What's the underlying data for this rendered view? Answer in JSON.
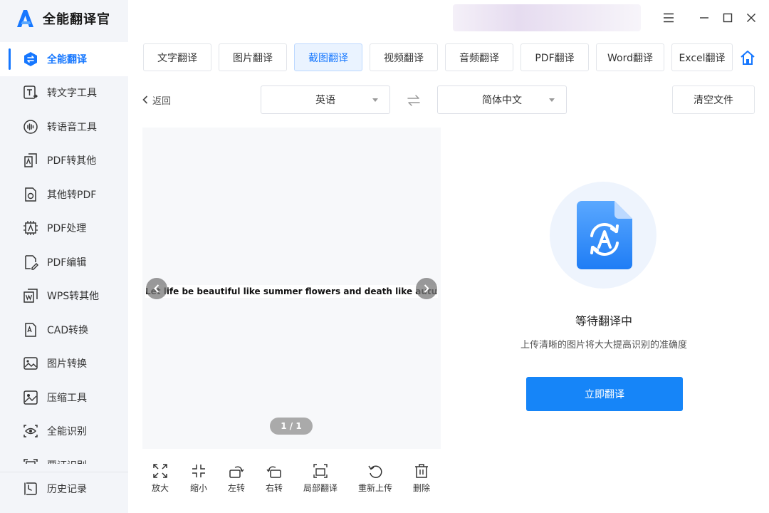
{
  "app": {
    "title": "全能翻译官",
    "accent_color": "#1677ff"
  },
  "sidebar": {
    "items": [
      {
        "label": "全能翻译",
        "icon": "translate-icon"
      },
      {
        "label": "转文字工具",
        "icon": "text-convert-icon"
      },
      {
        "label": "转语音工具",
        "icon": "voice-icon"
      },
      {
        "label": "PDF转其他",
        "icon": "pdf-export-icon"
      },
      {
        "label": "其他转PDF",
        "icon": "pdf-import-icon"
      },
      {
        "label": "PDF处理",
        "icon": "pdf-process-icon"
      },
      {
        "label": "PDF编辑",
        "icon": "pdf-edit-icon"
      },
      {
        "label": "WPS转其他",
        "icon": "wps-icon"
      },
      {
        "label": "CAD转换",
        "icon": "cad-icon"
      },
      {
        "label": "图片转换",
        "icon": "image-convert-icon"
      },
      {
        "label": "压缩工具",
        "icon": "compress-icon"
      },
      {
        "label": "全能识别",
        "icon": "eye-icon"
      },
      {
        "label": "票证识别",
        "icon": "ticket-icon"
      }
    ],
    "bottom_item": {
      "label": "历史记录",
      "icon": "history-icon"
    }
  },
  "tabs": [
    {
      "label": "文字翻译"
    },
    {
      "label": "图片翻译"
    },
    {
      "label": "截图翻译"
    },
    {
      "label": "视频翻译"
    },
    {
      "label": "音频翻译"
    },
    {
      "label": "PDF翻译"
    },
    {
      "label": "Word翻译"
    },
    {
      "label": "Excel翻译"
    }
  ],
  "toolbar": {
    "back_label": "返回",
    "source_lang": "英语",
    "target_lang": "简体中文",
    "clear_label": "清空文件"
  },
  "preview": {
    "image_text": "Let life be beautiful like summer flowers and death like autumn leaves.",
    "pager": "1 / 1"
  },
  "tools": [
    {
      "label": "放大",
      "icon": "zoom-in-icon"
    },
    {
      "label": "缩小",
      "icon": "zoom-out-icon"
    },
    {
      "label": "左转",
      "icon": "rotate-left-icon"
    },
    {
      "label": "右转",
      "icon": "rotate-right-icon"
    },
    {
      "label": "局部翻译",
      "icon": "partial-translate-icon"
    },
    {
      "label": "重新上传",
      "icon": "reupload-icon"
    },
    {
      "label": "删除",
      "icon": "delete-icon"
    }
  ],
  "status": {
    "title": "等待翻译中",
    "subtitle": "上传清晰的图片将大大提高识别的准确度",
    "button_label": "立即翻译"
  }
}
